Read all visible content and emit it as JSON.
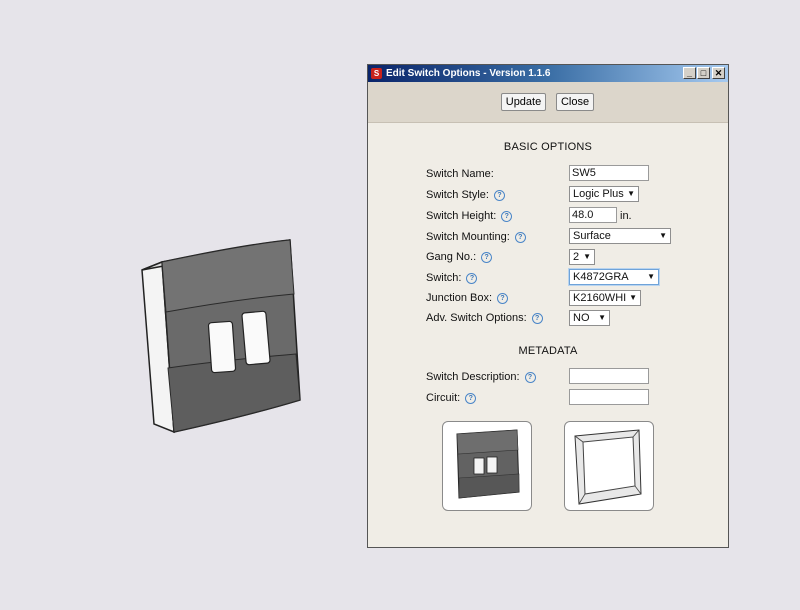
{
  "dialog": {
    "title": "Edit Switch Options - Version 1.1.6",
    "buttons": {
      "update": "Update",
      "close": "Close"
    },
    "basic_heading": "BASIC OPTIONS",
    "metadata_heading": "METADATA",
    "fields": {
      "switch_name": {
        "label": "Switch Name:",
        "value": "SW5"
      },
      "switch_style": {
        "label": "Switch Style:",
        "value": "Logic Plus"
      },
      "switch_height": {
        "label": "Switch Height:",
        "value": "48.0",
        "unit": "in."
      },
      "switch_mounting": {
        "label": "Switch Mounting:",
        "value": "Surface"
      },
      "gang_no": {
        "label": "Gang No.:",
        "value": "2"
      },
      "switch": {
        "label": "Switch:",
        "value": "K4872GRA"
      },
      "junction_box": {
        "label": "Junction Box:",
        "value": "K2160WHI"
      },
      "adv_switch_options": {
        "label": "Adv. Switch Options:",
        "value": "NO"
      },
      "switch_description": {
        "label": "Switch Description:",
        "value": ""
      },
      "circuit": {
        "label": "Circuit:",
        "value": ""
      }
    },
    "help_glyph": "?",
    "dropdown_arrow": "▼",
    "window_controls": {
      "minimize": "_",
      "maximize": "□",
      "close": "✕"
    },
    "app_icon_glyph": "S"
  },
  "colors": {
    "titlebar": "#0a246a",
    "toolbar": "#dcd6cb",
    "dialog_body": "#f0ede6",
    "help_icon": "#4a86c8",
    "plate_gray": "#6a6a6a"
  }
}
